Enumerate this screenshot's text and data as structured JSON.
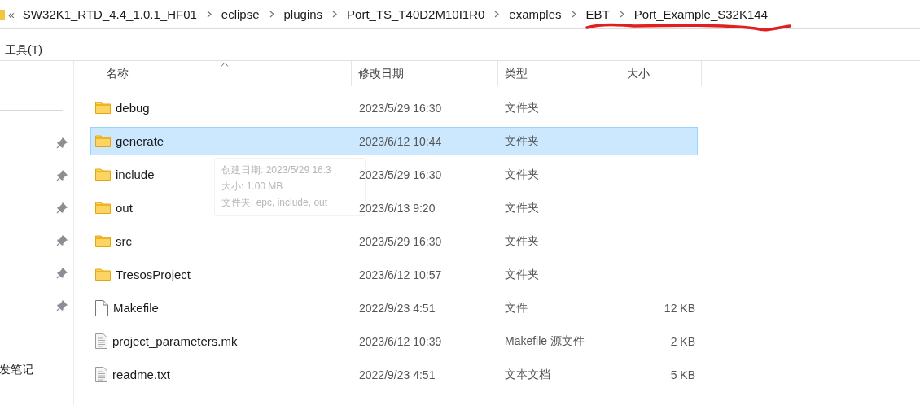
{
  "breadcrumb": {
    "overflow": "«",
    "items": [
      "SW32K1_RTD_4.4_1.0.1_HF01",
      "eclipse",
      "plugins",
      "Port_TS_T40D2M10I1R0",
      "examples",
      "EBT",
      "Port_Example_S32K144"
    ]
  },
  "annotation": {
    "kind": "underline"
  },
  "menu": [
    "工具(T)"
  ],
  "nav_pane": {
    "items": [
      "发笔记"
    ]
  },
  "columns": [
    {
      "label": "名称",
      "sorted": true
    },
    {
      "label": "修改日期",
      "sorted": false
    },
    {
      "label": "类型",
      "sorted": false
    },
    {
      "label": "大小",
      "sorted": false
    }
  ],
  "files": [
    {
      "name": "debug",
      "kind": "folder",
      "modified": "2023/5/29 16:30",
      "type": "文件夹",
      "selected": false
    },
    {
      "name": "generate",
      "kind": "folder",
      "modified": "2023/6/12 10:44",
      "type": "文件夹",
      "selected": true
    },
    {
      "name": "include",
      "kind": "folder",
      "modified": "2023/5/29 16:30",
      "type": "文件夹",
      "selected": false
    },
    {
      "name": "out",
      "kind": "folder",
      "modified": "2023/6/13 9:20",
      "type": "文件夹",
      "selected": false
    },
    {
      "name": "src",
      "kind": "folder",
      "modified": "2023/5/29 16:30",
      "type": "文件夹",
      "selected": false
    },
    {
      "name": "TresosProject",
      "kind": "folder",
      "modified": "2023/6/12 10:57",
      "type": "文件夹",
      "selected": false
    },
    {
      "name": "Makefile",
      "kind": "blank",
      "modified": "2022/9/23 4:51",
      "type": "文件",
      "size": "12 KB",
      "selected": false
    },
    {
      "name": "project_parameters.mk",
      "kind": "doc",
      "modified": "2023/6/12 10:39",
      "type": "Makefile 源文件",
      "size": "2 KB",
      "selected": false
    },
    {
      "name": "readme.txt",
      "kind": "doc",
      "modified": "2022/9/23 4:51",
      "type": "文本文档",
      "size": "5 KB",
      "selected": false
    }
  ],
  "tooltip": {
    "lines": [
      "创建日期: 2023/5/29 16:3",
      "大小: 1.00 MB",
      "文件夹: epc, include, out"
    ]
  }
}
